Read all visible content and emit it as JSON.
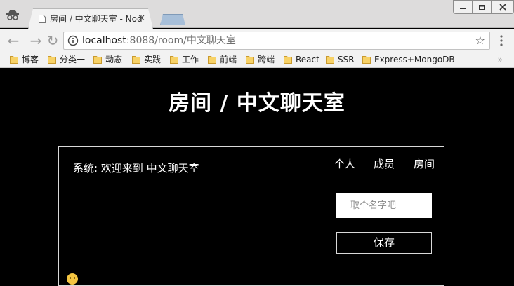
{
  "browser": {
    "tab_title": "房间 / 中文聊天室 - Nod",
    "tab_close": "✕",
    "url_host": "localhost",
    "url_rest": ":8088/room/中文聊天室",
    "star": "☆",
    "bookmarks": [
      "博客",
      "分类一",
      "动态",
      "实践",
      "工作",
      "前端",
      "跨端",
      "React",
      "SSR",
      "Express+MongoDB"
    ],
    "bookmarks_overflow": "»"
  },
  "page": {
    "title": "房间 / 中文聊天室",
    "messages": [
      {
        "text": "系统: 欢迎来到 中文聊天室"
      }
    ],
    "side_tabs": [
      "个人",
      "成员",
      "房间"
    ],
    "name_placeholder": "取个名字吧",
    "save_label": "保存"
  }
}
